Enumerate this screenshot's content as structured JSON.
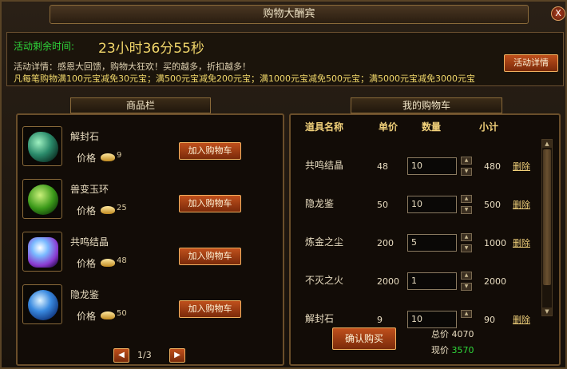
{
  "title": "购物大酬宾",
  "close_label": "X",
  "event": {
    "remain_label": "活动剩余时间:",
    "remain_time": "23小时36分55秒",
    "detail_line1": "活动详情：感恩大回馈，购物大狂欢！买的越多，折扣越多！",
    "detail_line2": "凡每笔购物满100元宝减免30元宝；满500元宝减免200元宝；满1000元宝减免500元宝；满5000元宝减免3000元宝",
    "detail_button": "活动详情"
  },
  "products": {
    "tab": "商品栏",
    "price_label": "价格",
    "add_label": "加入购物车",
    "items": [
      {
        "name": "解封石",
        "price": "9"
      },
      {
        "name": "兽变玉环",
        "price": "25"
      },
      {
        "name": "共鸣结晶",
        "price": "48"
      },
      {
        "name": "隐龙鉴",
        "price": "50"
      }
    ],
    "pager": "1/3"
  },
  "cart": {
    "tab": "我的购物车",
    "headers": {
      "name": "道具名称",
      "price": "单价",
      "qty": "数量",
      "subtotal": "小计"
    },
    "delete_label": "删除",
    "rows": [
      {
        "name": "共鸣结晶",
        "price": "48",
        "qty": "10",
        "subtotal": "480"
      },
      {
        "name": "隐龙鉴",
        "price": "50",
        "qty": "10",
        "subtotal": "500"
      },
      {
        "name": "炼金之尘",
        "price": "200",
        "qty": "5",
        "subtotal": "1000"
      },
      {
        "name": "不灭之火",
        "price": "2000",
        "qty": "1",
        "subtotal": "2000"
      },
      {
        "name": "解封石",
        "price": "9",
        "qty": "10",
        "subtotal": "90"
      }
    ],
    "confirm": "确认购买",
    "total_label": "总价",
    "total_value": "4070",
    "now_label": "现价",
    "now_value": "3570"
  },
  "colors": {
    "accent": "#f0d56a",
    "green": "#2ed63a",
    "button": "#c0501c"
  }
}
